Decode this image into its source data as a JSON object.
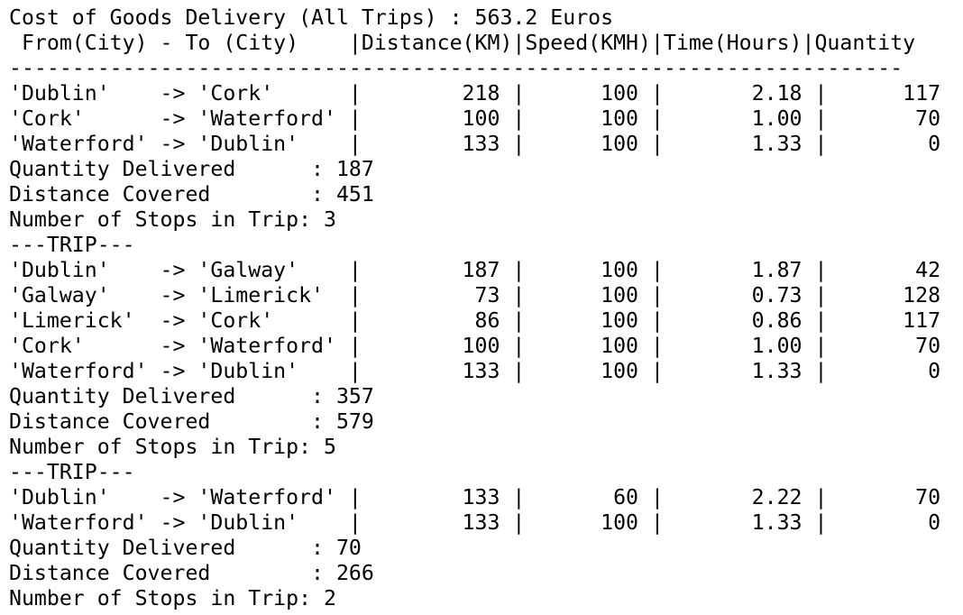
{
  "terminal": {
    "lines": [
      "Cost of Goods Delivery (All Trips) : 563.2 Euros",
      " From(City) - To (City)    |Distance(KM)|Speed(KMH)|Time(Hours)|Quantity",
      "-----------------------------------------------------------------------",
      "'Dublin'    -> 'Cork'      |        218 |      100 |       2.18 |      117",
      "'Cork'      -> 'Waterford' |        100 |      100 |       1.00 |       70",
      "'Waterford' -> 'Dublin'    |        133 |      100 |       1.33 |        0",
      "Quantity Delivered      : 187",
      "Distance Covered        : 451",
      "Number of Stops in Trip: 3",
      "---TRIP---",
      "'Dublin'    -> 'Galway'    |        187 |      100 |       1.87 |       42",
      "'Galway'    -> 'Limerick'  |         73 |      100 |       0.73 |      128",
      "'Limerick'  -> 'Cork'      |         86 |      100 |       0.86 |      117",
      "'Cork'      -> 'Waterford' |        100 |      100 |       1.00 |       70",
      "'Waterford' -> 'Dublin'    |        133 |      100 |       1.33 |        0",
      "Quantity Delivered      : 357",
      "Distance Covered        : 579",
      "Number of Stops in Trip: 5",
      "---TRIP---",
      "'Dublin'    -> 'Waterford' |        133 |       60 |       2.22 |       70",
      "'Waterford' -> 'Dublin'    |        133 |      100 |       1.33 |        0",
      "Quantity Delivered      : 70",
      "Distance Covered        : 266",
      "Number of Stops in Trip: 2"
    ]
  }
}
